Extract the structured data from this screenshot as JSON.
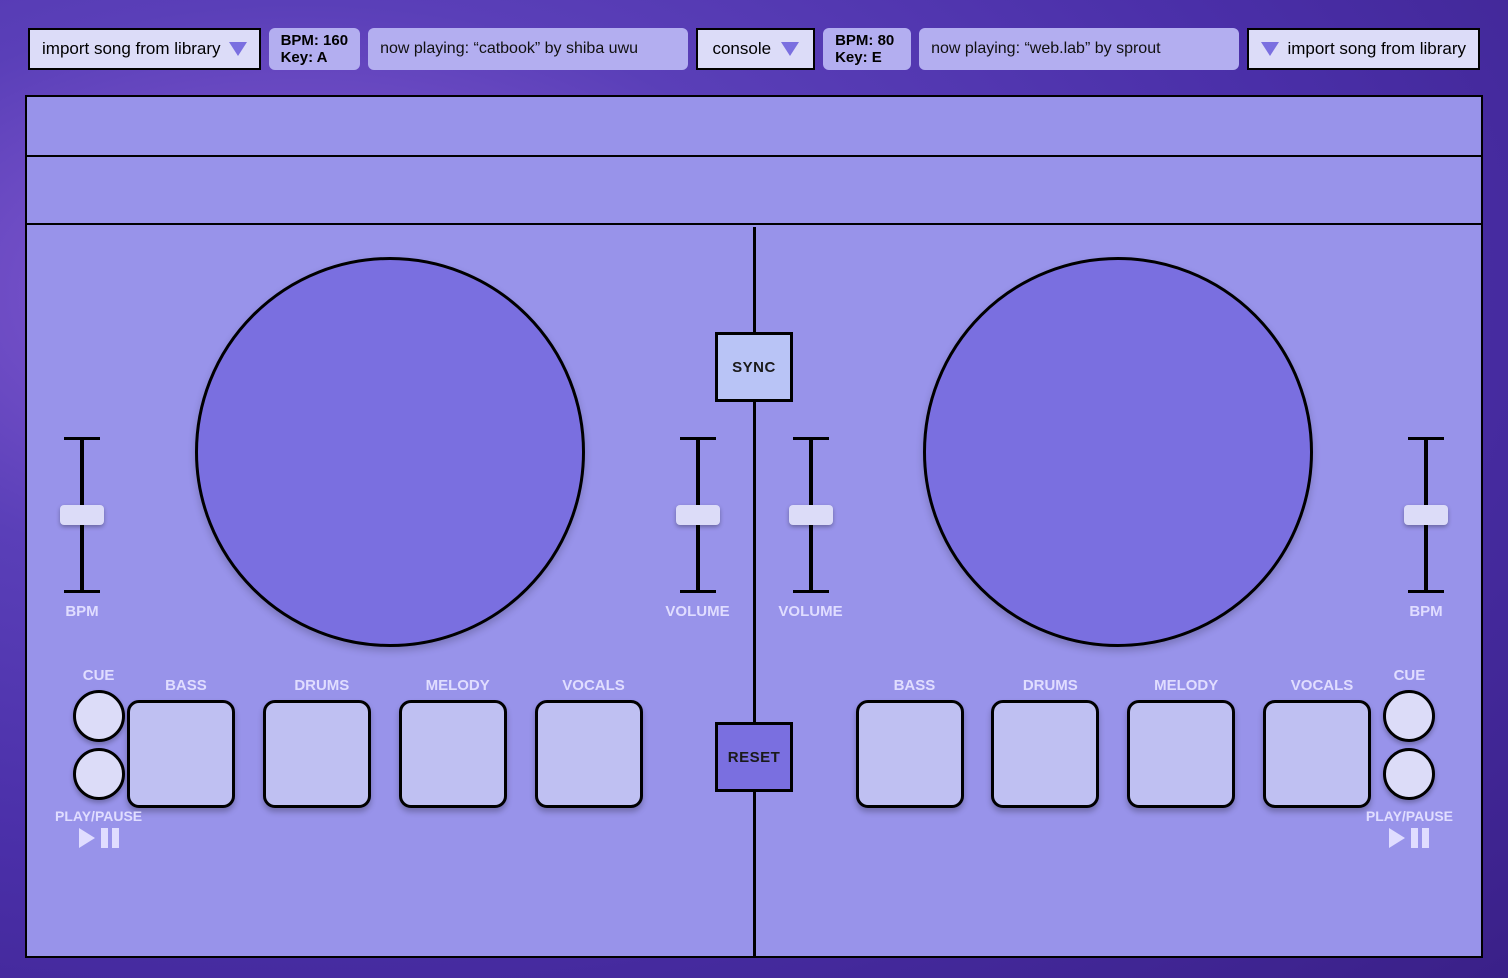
{
  "header": {
    "left": {
      "import_label": "import song from library",
      "bpm_line": "BPM: 160",
      "key_line": "Key: A",
      "now_playing": "now playing: “catbook” by shiba uwu"
    },
    "console_label": "console",
    "right": {
      "bpm_line": "BPM: 80",
      "key_line": "Key: E",
      "now_playing": "now playing: “web.lab” by sprout",
      "import_label": "import song from library"
    }
  },
  "center": {
    "sync": "SYNC",
    "reset": "RESET"
  },
  "deck_left": {
    "bpm_label": "BPM",
    "vol_label": "VOLUME",
    "cue_label": "CUE",
    "pp_label": "PLAY/PAUSE",
    "pads": [
      "BASS",
      "DRUMS",
      "MELODY",
      "VOCALS"
    ]
  },
  "deck_right": {
    "bpm_label": "BPM",
    "vol_label": "VOLUME",
    "cue_label": "CUE",
    "pp_label": "PLAY/PAUSE",
    "pads": [
      "BASS",
      "DRUMS",
      "MELODY",
      "VOCALS"
    ]
  }
}
